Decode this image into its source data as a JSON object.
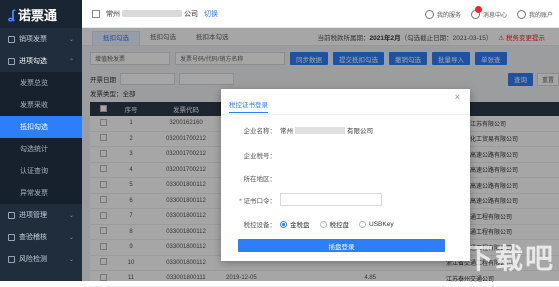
{
  "app": {
    "logo_text": "诺票通"
  },
  "sidebar": {
    "groups": [
      {
        "label": "销项发票",
        "expanded": false
      },
      {
        "label": "进项勾选",
        "expanded": true
      }
    ],
    "sub_items": [
      {
        "label": "发票总览",
        "active": false
      },
      {
        "label": "发票采收",
        "active": false
      },
      {
        "label": "抵扣勾选",
        "active": true
      },
      {
        "label": "勾选统计",
        "active": false
      },
      {
        "label": "认证查询",
        "active": false
      },
      {
        "label": "异常发票",
        "active": false
      }
    ],
    "bottom_groups": [
      {
        "label": "进项管理"
      },
      {
        "label": "查验稽核"
      },
      {
        "label": "风险检测"
      }
    ]
  },
  "topbar": {
    "company_prefix": "常州",
    "company_suffix": "公司",
    "switch_label": "切换",
    "service_label": "我的服务",
    "message_label": "消息中心",
    "account_label": "我的账户"
  },
  "tabs": [
    {
      "label": "抵扣勾选",
      "active": true
    },
    {
      "label": "抵扣勾选",
      "active": false
    },
    {
      "label": "抵扣本勾选",
      "active": false
    }
  ],
  "period": {
    "text": "当前税款所属期：",
    "month": "2021年2月",
    "deadline": "（勾选截止日期：2021-03-15）",
    "notice": "⚠ 税务变更提示"
  },
  "toolbar": {
    "select_placeholder": "增值税发票",
    "search_placeholder": "发票号码/代码/销方名称",
    "buttons": [
      "同步数据",
      "提交抵扣勾选",
      "撤销勾选",
      "批量导入",
      "单张查"
    ]
  },
  "filter": {
    "label": "开票日期",
    "search_button": "查询",
    "reset_button": "重置"
  },
  "type_row": {
    "label": "发票类型：",
    "value": "全部"
  },
  "table": {
    "headers": [
      "序号",
      "发票代码",
      "",
      "",
      "销方"
    ],
    "rows": [
      {
        "no": "1",
        "code": "3200162160",
        "seller": "航天信息江苏有限公司"
      },
      {
        "no": "2",
        "code": "032001700212",
        "seller": "江苏广博化工贸易有限公司"
      },
      {
        "no": "3",
        "code": "032001700212",
        "seller": "江苏宁和高速公路有限公司"
      },
      {
        "no": "4",
        "code": "032001700212",
        "seller": "江苏宁和高速公路有限公司"
      },
      {
        "no": "5",
        "code": "033001800112",
        "seller": "浙江广达高速公路有限公司"
      },
      {
        "no": "6",
        "code": "033001800112",
        "seller": "浙江广达高速公路有限公司"
      },
      {
        "no": "7",
        "code": "033001800112",
        "seller": "浙江省交通工程有限公司"
      },
      {
        "no": "8",
        "code": "033001800112",
        "seller": "浙江省交通工程有限公司"
      },
      {
        "no": "9",
        "code": "033001800112",
        "seller": "浙江省交通工程有限公司"
      },
      {
        "no": "10",
        "code": "033001800112",
        "seller": "浙江省交通工程有限公司"
      },
      {
        "no": "11",
        "code": "033001800111",
        "seller": "江苏泰州交通公司"
      }
    ],
    "last_row_extra": {
      "date": "2019-12-05",
      "amount": "4.85",
      "tax": "0.15"
    }
  },
  "dialog": {
    "title": "税控证书登录",
    "close_label": "×",
    "company_name_label": "企业名称：",
    "company_name_prefix": "常州",
    "company_name_suffix": "有限公司",
    "tax_id_label": "企业税号：",
    "region_label": "所在地区：",
    "password_label": "证书口令：",
    "device_label": "税控设备：",
    "device_options": [
      {
        "label": "金税盘",
        "selected": true
      },
      {
        "label": "税控盘",
        "selected": false
      },
      {
        "label": "USBKey",
        "selected": false
      }
    ],
    "login_button": "插盘登录"
  },
  "watermark": "下载吧"
}
